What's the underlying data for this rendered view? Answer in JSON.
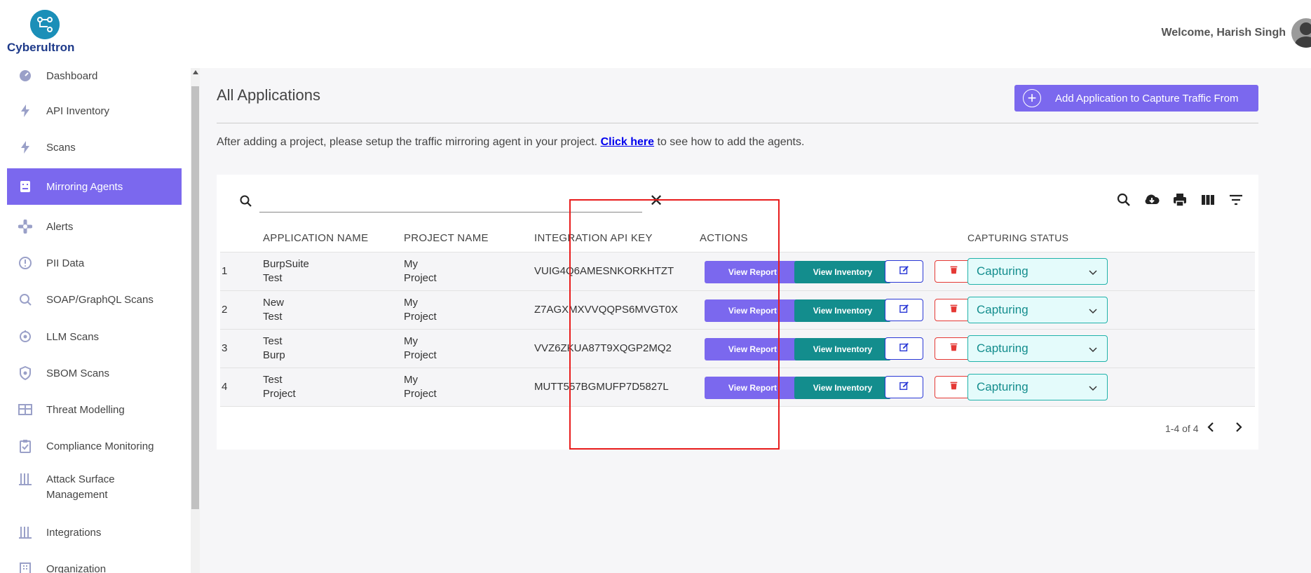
{
  "header": {
    "brand": "Cyberultron",
    "welcome": "Welcome, Harish Singh"
  },
  "sidebar": {
    "items": [
      {
        "label": "Dashboard",
        "icon": "dashboard-icon"
      },
      {
        "label": "API Inventory",
        "icon": "bolt-icon"
      },
      {
        "label": "Scans",
        "icon": "bolt-icon"
      },
      {
        "label": "Mirroring Agents",
        "icon": "agent-icon",
        "active": true
      },
      {
        "label": "Alerts",
        "icon": "alert-icon"
      },
      {
        "label": "PII Data",
        "icon": "info-circle-icon"
      },
      {
        "label": "SOAP/GraphQL Scans",
        "icon": "search-icon"
      },
      {
        "label": "LLM Scans",
        "icon": "llm-icon"
      },
      {
        "label": "SBOM Scans",
        "icon": "shield-icon"
      },
      {
        "label": "Threat Modelling",
        "icon": "table-icon"
      },
      {
        "label": "Compliance Monitoring",
        "icon": "clipboard-icon"
      },
      {
        "label": "Attack Surface Management",
        "icon": "bars-icon"
      },
      {
        "label": "Integrations",
        "icon": "bars-icon"
      },
      {
        "label": "Organization",
        "icon": "building-icon"
      }
    ]
  },
  "main": {
    "title": "All Applications",
    "add_button": "Add Application to Capture Traffic From",
    "info_prefix": "After adding a project, please setup the traffic mirroring agent in your project.",
    "info_link": "Click here",
    "info_suffix": "to see how to add the agents."
  },
  "table": {
    "columns": [
      "APPLICATION NAME",
      "PROJECT NAME",
      "INTEGRATION API KEY",
      "ACTIONS",
      "CAPTURING STATUS"
    ],
    "rows": [
      {
        "index": "1",
        "app_line1": "BurpSuite",
        "app_line2": "Test",
        "proj_line1": "My",
        "proj_line2": "Project",
        "key": "VUIG4Q6AMESNKORKHTZT",
        "status": "Capturing"
      },
      {
        "index": "2",
        "app_line1": "New",
        "app_line2": "Test",
        "proj_line1": "My",
        "proj_line2": "Project",
        "key": "Z7AGXMXVVQQPS6MVGT0X",
        "status": "Capturing"
      },
      {
        "index": "3",
        "app_line1": "Test",
        "app_line2": "Burp",
        "proj_line1": "My",
        "proj_line2": "Project",
        "key": "VVZ6ZKUA87T9XQGP2MQ2",
        "status": "Capturing"
      },
      {
        "index": "4",
        "app_line1": "Test",
        "app_line2": "Project",
        "proj_line1": "My",
        "proj_line2": "Project",
        "key": "MUTT557BGMUFP7D5827L",
        "status": "Capturing"
      }
    ],
    "view_report_label": "View Report",
    "view_inventory_label": "View Inventory",
    "pagination": "1-4 of 4"
  },
  "colors": {
    "accent": "#7b68ee",
    "teal": "#138d8d",
    "highlight_box": "#e81c1c"
  }
}
